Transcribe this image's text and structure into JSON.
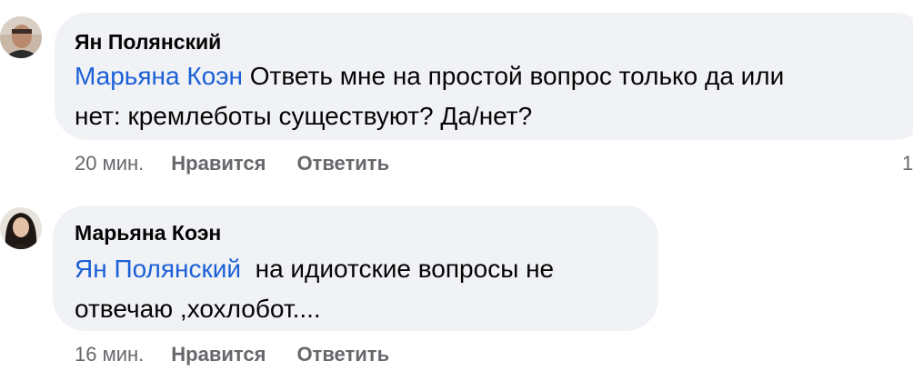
{
  "comments": [
    {
      "author": "Ян Полянский",
      "mention": "Марьяна Коэн",
      "text_line1": " Ответь мне на простой вопрос только да или",
      "text_line2": "нет: кремлеботы существуют? Да/нет?",
      "time": "20 мин.",
      "like_label": "Нравится",
      "reply_label": "Ответить",
      "reaction_count": "1"
    },
    {
      "author": "Марьяна Коэн",
      "mention": "Ян Полянский",
      "text_line1": "  на идиотские вопросы не",
      "text_line2": "отвечаю ,хохлобот....",
      "time": "16 мин.",
      "like_label": "Нравится",
      "reply_label": "Ответить"
    }
  ],
  "colors": {
    "bubble": "#f0f2f5",
    "mention": "#1b5fd6",
    "meta": "#65676b",
    "text": "#050505"
  }
}
